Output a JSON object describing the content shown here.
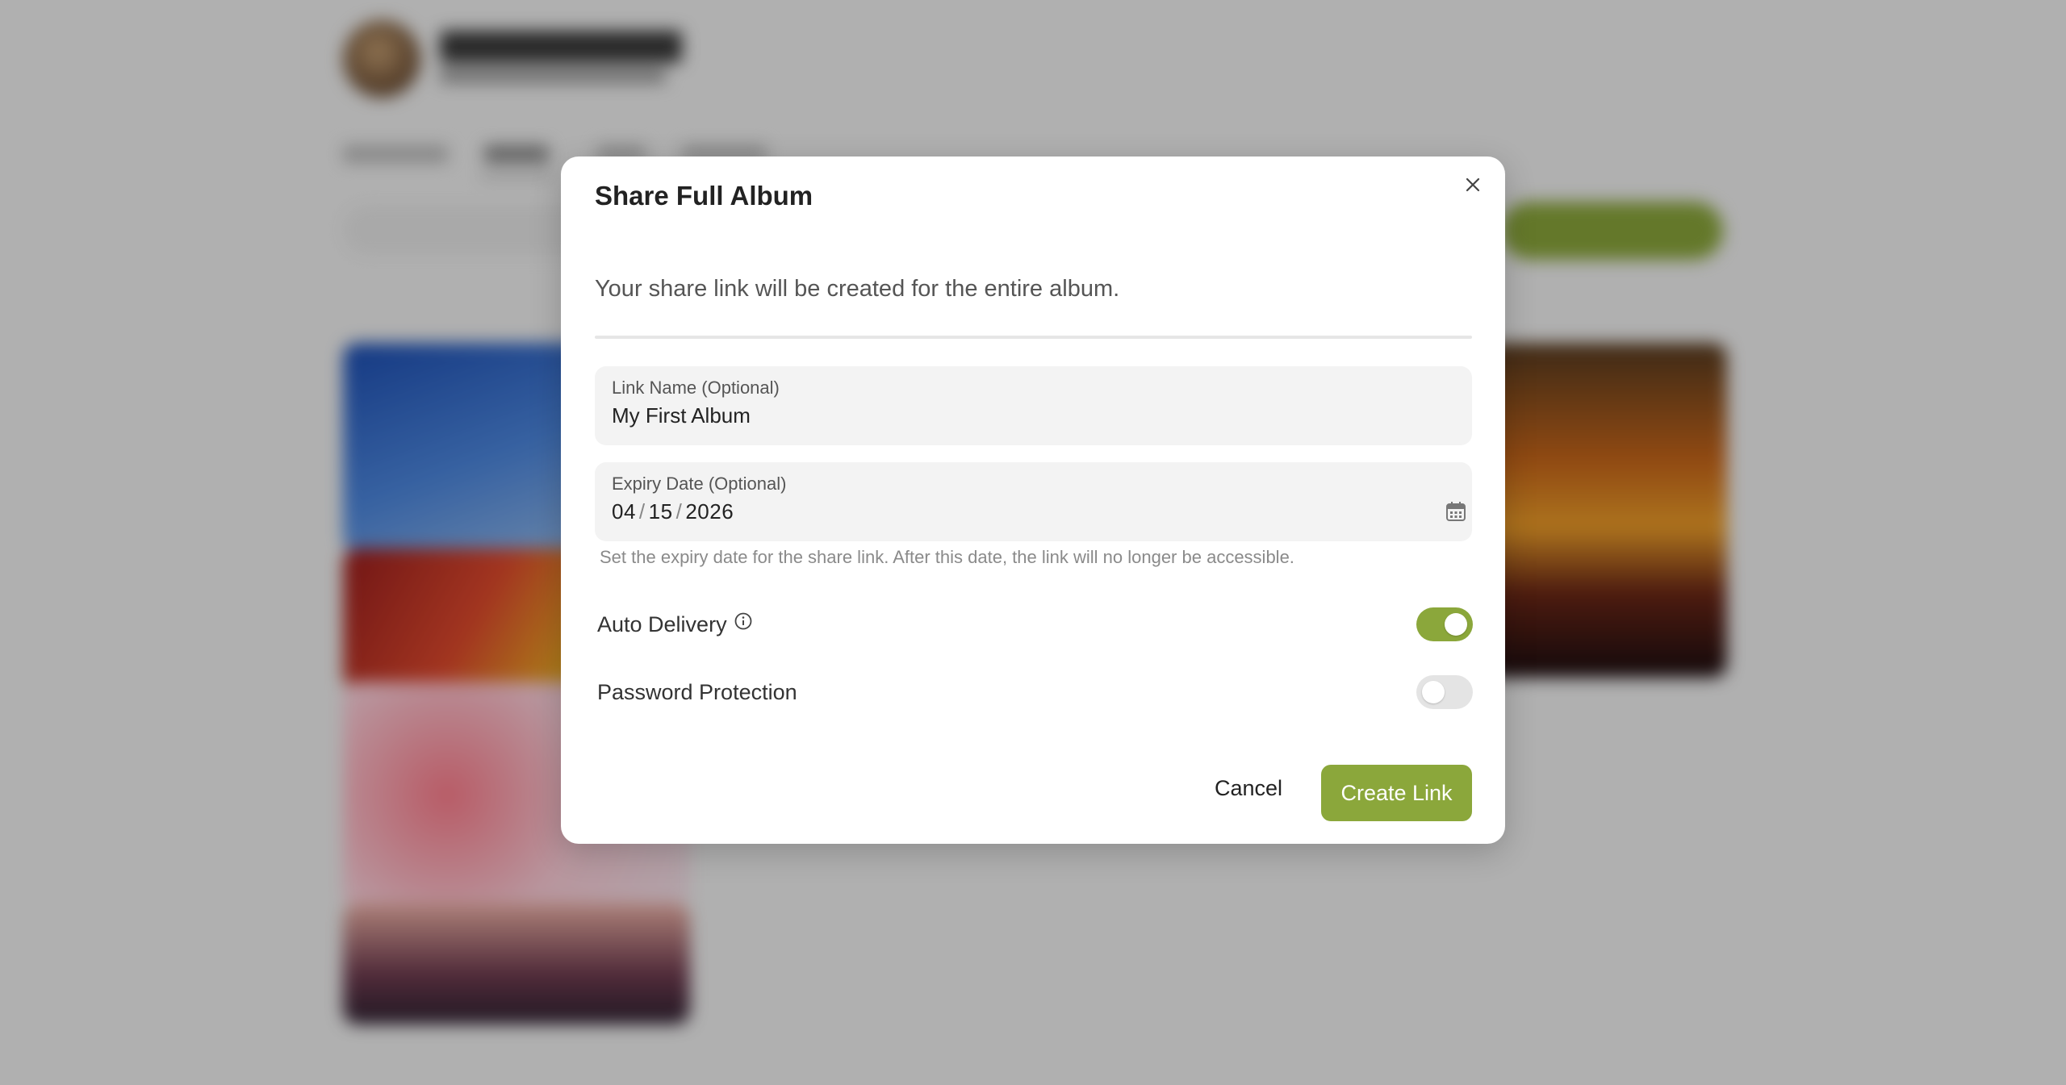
{
  "dialog": {
    "title": "Share Full Album",
    "description": "Your share link will be created for the entire album.",
    "link_name": {
      "label": "Link Name (Optional)",
      "value": "My First Album"
    },
    "expiry_date": {
      "label": "Expiry Date (Optional)",
      "month": "04",
      "day": "15",
      "year": "2026",
      "separator": "/",
      "helper": "Set the expiry date for the share link. After this date, the link will no longer be accessible."
    },
    "auto_delivery": {
      "label": "Auto Delivery",
      "enabled": true
    },
    "password_protection": {
      "label": "Password Protection",
      "enabled": false
    },
    "cancel_label": "Cancel",
    "create_label": "Create Link"
  },
  "colors": {
    "accent": "#8ba73b",
    "overlay": "rgba(0,0,0,0.28)"
  },
  "icons": {
    "close": "close-icon",
    "calendar": "calendar-icon",
    "info": "info-icon"
  }
}
